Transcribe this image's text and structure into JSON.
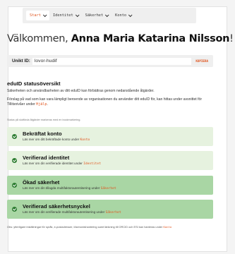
{
  "nav": {
    "items": [
      {
        "label": "Start"
      },
      {
        "label": "Identitet"
      },
      {
        "label": "Säkerhet"
      },
      {
        "label": "Konto"
      }
    ]
  },
  "header": {
    "greeting": "Välkommen,",
    "name": "Anna Maria Katarina Nilsson",
    "exclaim": "!"
  },
  "uid": {
    "label": "Unikt ID:",
    "value": "lovor-hudif",
    "copy": "KOPIERA"
  },
  "overview": {
    "title": "eduID statusöversikt",
    "p1": "Säkerheten och användbarheten av ditt eduID kan förbättras genom nedanstående åtgärder.",
    "p2a": "Förslag på vad som kan vara lämpligt beroende av organisationen du använder ditt eduID för, kan hittas under avsnittet för Tillitsnivåer under ",
    "p2link": "Hjälp",
    "p2b": ".",
    "hint": "Status på slutförda åtgärder markeras med en bockmarkering."
  },
  "steps": [
    {
      "title": "Bekräftat konto",
      "sub": "Läs mer om ditt bekräftade konto under ",
      "link": "Konto"
    },
    {
      "title": "Verifierad identitet",
      "sub": "Läs mer om din verifierade identitet under ",
      "link": "Identitet"
    },
    {
      "title": "Ökad säkerhet",
      "sub": "Läs mer om din tillagda multifaktorautentisering under ",
      "link": "Säkerhet"
    },
    {
      "title": "Verifierad säkerhetsnyckel",
      "sub": "Läs mer om din verifierade multifaktorautentisering under ",
      "link": "Säkerhet"
    }
  ],
  "footnote": {
    "text": "Obs: ytterligare inställningar för språk, e-postadresser, lösenordshantering samt länkning till ORCID och ESI kan hanteras under ",
    "link": "Konto"
  },
  "colors": {
    "accent": "#e0551e",
    "check": "#2e7d32",
    "step_light": "#e6f2df",
    "step_dark": "#a9d6a4"
  }
}
